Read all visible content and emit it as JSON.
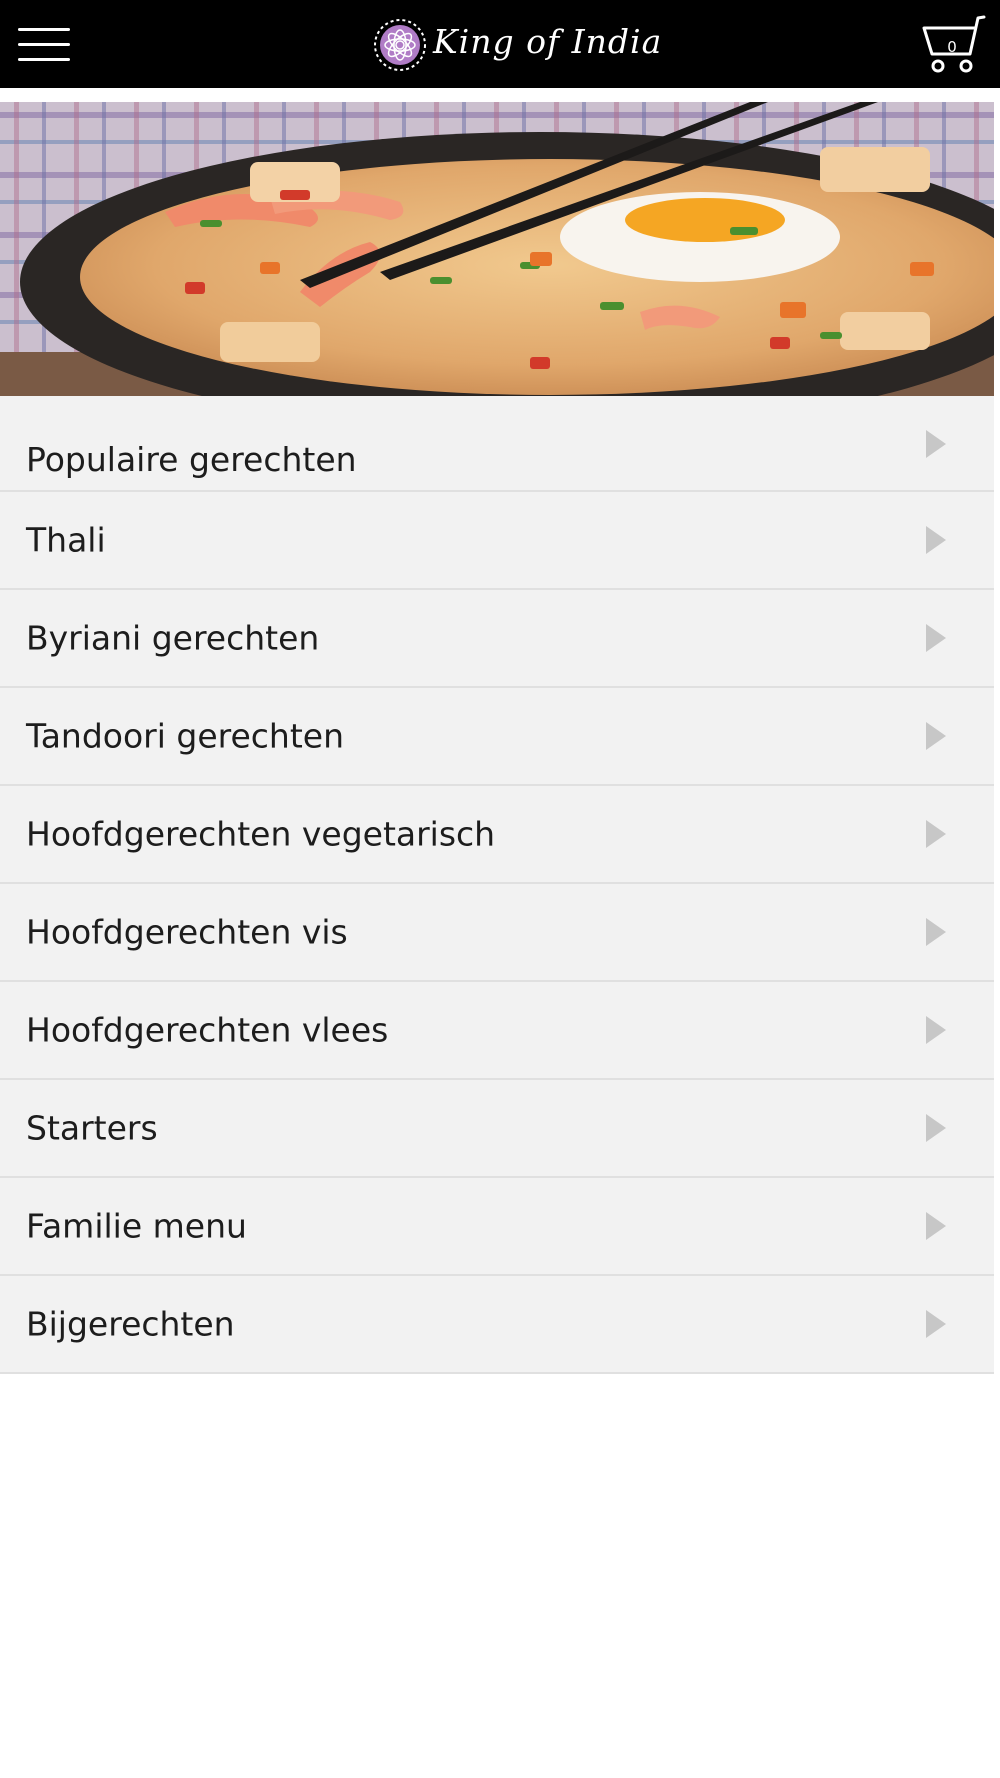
{
  "header": {
    "brand": "King of India",
    "cart_count": "0"
  },
  "hero": {
    "icon": "fried-rice-photo"
  },
  "menu": {
    "items": [
      {
        "label": "Populaire gerechten"
      },
      {
        "label": "Thali"
      },
      {
        "label": "Byriani gerechten"
      },
      {
        "label": "Tandoori gerechten"
      },
      {
        "label": "Hoofdgerechten vegetarisch"
      },
      {
        "label": "Hoofdgerechten vis"
      },
      {
        "label": "Hoofdgerechten vlees"
      },
      {
        "label": "Starters"
      },
      {
        "label": "Familie menu"
      },
      {
        "label": "Bijgerechten"
      }
    ]
  },
  "colors": {
    "header_bg": "#000000",
    "menu_bg": "#f2f2f2",
    "divider": "#e0e0e0",
    "arrow": "#c7c7c7",
    "logo_accent": "#b07cc6"
  }
}
